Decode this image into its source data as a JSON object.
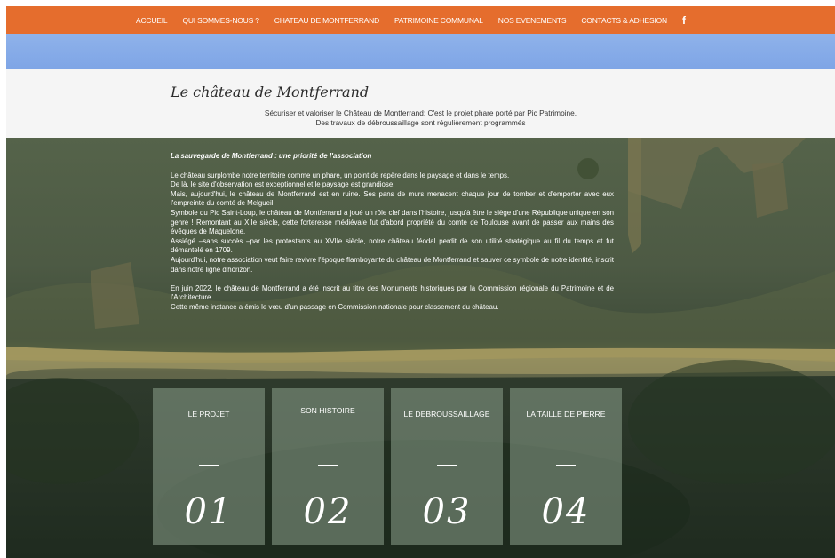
{
  "nav": {
    "items": [
      {
        "label": "ACCUEIL"
      },
      {
        "label": "QUI SOMMES-NOUS ?"
      },
      {
        "label": "CHATEAU DE MONTFERRAND"
      },
      {
        "label": "PATRIMOINE COMMUNAL"
      },
      {
        "label": "NOS EVENEMENTS"
      },
      {
        "label": "CONTACTS & ADHESION"
      }
    ],
    "facebook_icon": "f"
  },
  "header": {
    "title": "Le château de Montferrand",
    "subtitle_line1": "Sécuriser et valoriser le Château de Montferrand: C'est le projet phare porté par Pic Patrimoine.",
    "subtitle_line2": "Des travaux de débroussaillage sont régulièrement programmés"
  },
  "content": {
    "lead": "La sauvegarde de Montferrand : une priorité de l'association",
    "paragraphs": [
      "Le château surplombe notre territoire comme un phare, un point de repère dans le paysage et dans le temps.",
      "De là, le site d'observation est exceptionnel et le paysage est grandiose.",
      "Mais, aujourd'hui, le château de Montferrand est en ruine. Ses pans de murs menacent chaque jour de tomber et d'emporter avec eux l'empreinte du comté de Melgueil.",
      "Symbole du Pic Saint-Loup, le château de Montferrand a joué un rôle clef dans l'histoire, jusqu'à être le siège d'une République unique en son genre ! Remontant au XIIe siècle, cette forteresse médiévale fut d'abord propriété du comte de Toulouse avant de passer aux mains des évêques de Maguelone.",
      "Assiégé –sans succès –par les protestants au XVIIe siècle, notre château féodal perdit de son utilité stratégique au fil du temps et fut démantelé en 1709.",
      "Aujourd'hui, notre association veut faire revivre l'époque flamboyante du château de Montferrand et sauver ce symbole de notre identité, inscrit dans notre ligne d'horizon."
    ],
    "paragraphs2": [
      "En juin 2022, le château de Montferrand a été inscrit au titre des Monuments historiques par la Commission régionale du Patrimoine et de l'Architecture.",
      "Cette même instance a émis le vœu d'un passage en Commission nationale pour classement du château."
    ]
  },
  "cards": [
    {
      "label": "LE PROJET",
      "number": "01"
    },
    {
      "label": "SON HISTOIRE",
      "number": "02"
    },
    {
      "label": "LE DEBROUSSAILLAGE",
      "number": "03"
    },
    {
      "label": "LA TAILLE DE PIERRE",
      "number": "04"
    }
  ]
}
